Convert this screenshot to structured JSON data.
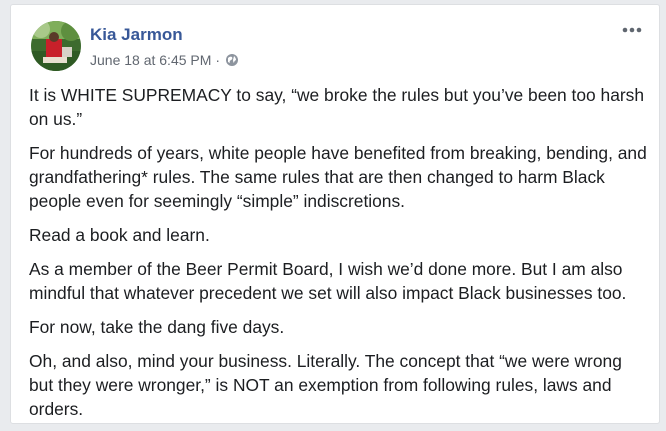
{
  "post": {
    "author": "Kia Jarmon",
    "timestamp": "June 18 at 6:45 PM",
    "separator": "·",
    "privacy_icon": "globe-icon",
    "more_icon": "more-options-icon",
    "paragraphs": [
      "It is WHITE SUPREMACY to say, “we broke the rules but you’ve been too harsh on us.”",
      "For hundreds of years, white people have benefited from breaking, bending, and grandfathering* rules. The same rules that are then changed to harm Black people even for seemingly “simple” indiscretions.",
      "Read a book and learn.",
      "As a member of the Beer Permit Board, I wish we’d done more. But I am also mindful that whatever precedent we set will also impact Black businesses too.",
      "For now, take the dang five days.",
      "Oh, and also, mind your business. Literally. The concept that “we were wrong but they were wronger,” is NOT an exemption from following rules, laws and orders."
    ]
  },
  "colors": {
    "author": "#385898",
    "meta": "#616770",
    "text": "#1c1e21",
    "background": "#e9ebee",
    "card": "#ffffff"
  }
}
